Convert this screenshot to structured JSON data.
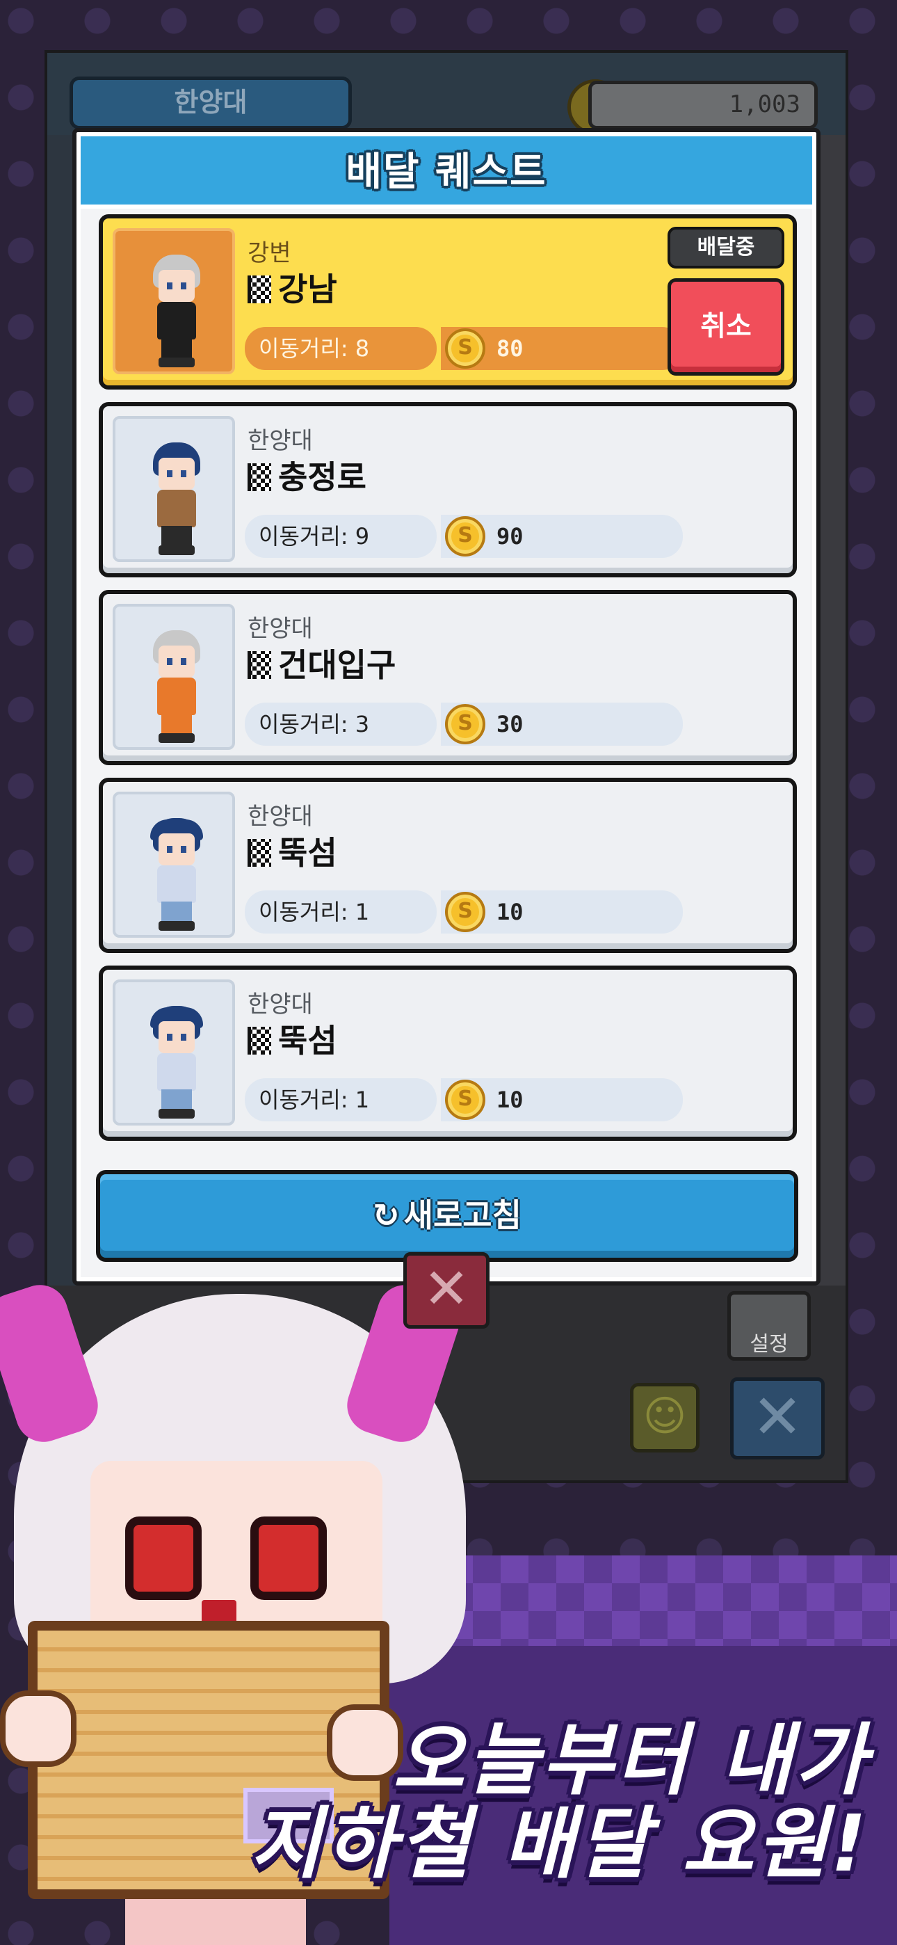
{
  "background": {
    "station_tab": "한양대",
    "coin_total": "1,003",
    "settings_label": "설정"
  },
  "modal": {
    "title": "배달 퀘스트",
    "refresh_label": "새로고침",
    "refresh_icon": "↻"
  },
  "quests": [
    {
      "origin": "강변",
      "destination": "강남",
      "distance_label": "이동거리: 8",
      "reward": "80",
      "status": "배달중",
      "cancel_label": "취소",
      "active": true,
      "character": {
        "hair": "#c8c8c8",
        "body": "#1e1e1e",
        "legs": "#1e1e1e"
      }
    },
    {
      "origin": "한양대",
      "destination": "충정로",
      "distance_label": "이동거리: 9",
      "reward": "90",
      "active": false,
      "character": {
        "hair": "#1f3f7a",
        "body": "#9b6a3f",
        "legs": "#2a2a2a"
      }
    },
    {
      "origin": "한양대",
      "destination": "건대입구",
      "distance_label": "이동거리: 3",
      "reward": "30",
      "active": false,
      "character": {
        "hair": "#c8c8c8",
        "body": "#e8792b",
        "legs": "#e8792b"
      }
    },
    {
      "origin": "한양대",
      "destination": "뚝섬",
      "distance_label": "이동거리: 1",
      "reward": "10",
      "active": false,
      "character": {
        "hair": "#1f3f7a",
        "body": "#cfd9ec",
        "legs": "#7fa3cf",
        "cap": "#1f3f7a"
      }
    },
    {
      "origin": "한양대",
      "destination": "뚝섬",
      "distance_label": "이동거리: 1",
      "reward": "10",
      "active": false,
      "character": {
        "hair": "#1f3f7a",
        "body": "#cfd9ec",
        "legs": "#7fa3cf",
        "cap": "#1f3f7a"
      }
    }
  ],
  "coin_symbol": "S",
  "promo": {
    "line1": "오늘부터 내가",
    "line2": "지하철 배달 요원!"
  }
}
